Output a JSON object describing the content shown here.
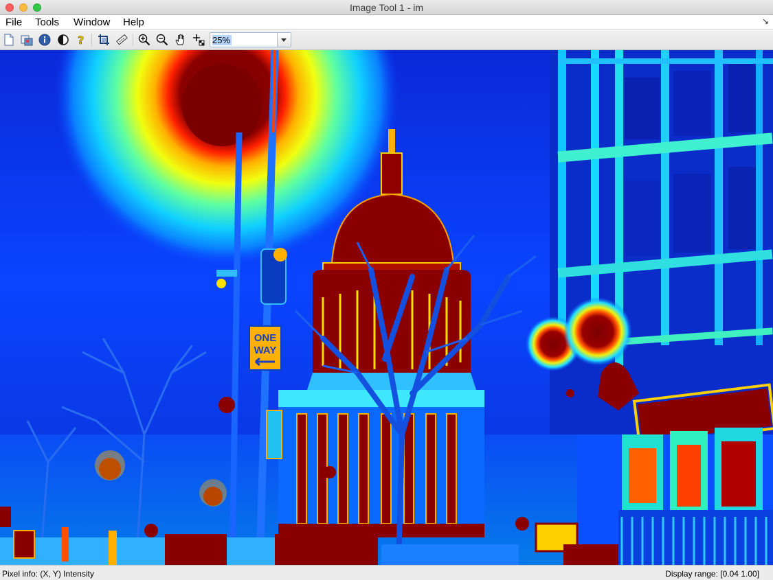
{
  "window": {
    "title": "Image Tool 1 - im"
  },
  "menu": {
    "items": [
      "File",
      "Tools",
      "Window",
      "Help"
    ],
    "corner_glyph": "↘"
  },
  "toolbar": {
    "buttons": [
      "new-image-icon",
      "export-image-icon",
      "image-info-icon",
      "contrast-icon",
      "help-icon",
      "crop-icon",
      "distance-tool-icon",
      "zoom-in-icon",
      "zoom-out-icon",
      "pan-icon",
      "pixel-region-icon"
    ],
    "zoom_value": "25%"
  },
  "image": {
    "description_colormap": "jet",
    "sign_top": "ONE",
    "sign_bottom": "WAY"
  },
  "status": {
    "pixel_info": "Pixel info: (X, Y)  Intensity",
    "display_range": "Display range: [0.04 1.00]"
  }
}
